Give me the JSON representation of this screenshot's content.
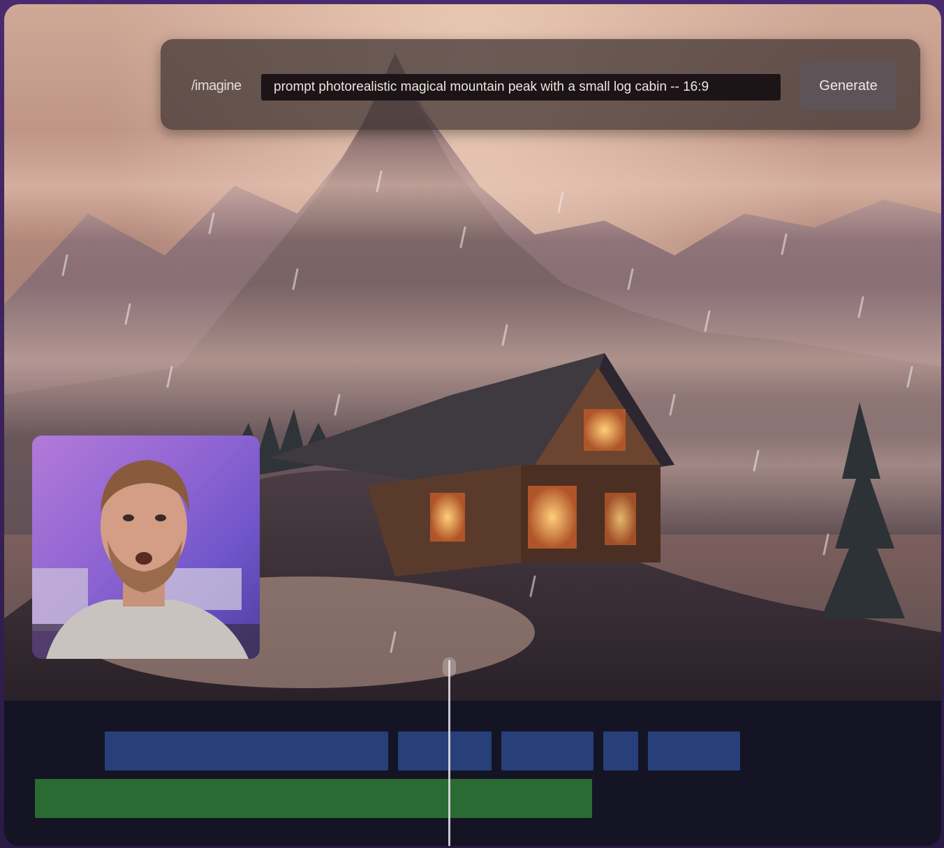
{
  "prompt_bar": {
    "command": "/imagine",
    "prompt_value": "prompt photorealistic magical mountain peak with a small log cabin -- 16:9",
    "generate_label": "Generate"
  },
  "timeline": {
    "video_track_color": "#27407a",
    "audio_track_color": "#2b6a33",
    "video_clips": 5,
    "audio_clips": 1
  },
  "colors": {
    "background": "#3a1f5c",
    "timeline_bg": "#141424"
  }
}
